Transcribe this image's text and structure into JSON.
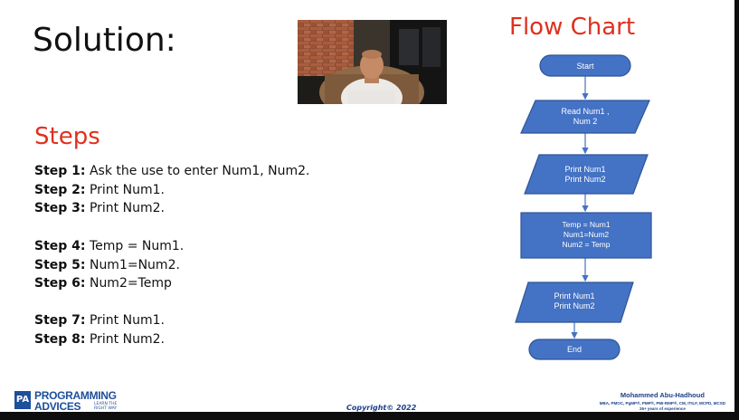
{
  "slide": {
    "title": "Solution:",
    "steps_heading": "Steps",
    "steps": [
      {
        "label": "Step 1:",
        "text": " Ask the use to enter Num1, Num2."
      },
      {
        "label": "Step 2:",
        "text": " Print Num1."
      },
      {
        "label": "Step 3:",
        "text": " Print Num2."
      },
      {
        "label": "Step 4:",
        "text": " Temp = Num1."
      },
      {
        "label": "Step 5:",
        "text": " Num1=Num2."
      },
      {
        "label": "Step 6:",
        "text": " Num2=Temp"
      },
      {
        "label": "Step 7:",
        "text": " Print Num1."
      },
      {
        "label": "Step 8:",
        "text": " Print Num2."
      }
    ],
    "flowchart": {
      "title": "Flow Chart",
      "start": "Start",
      "read": [
        "Read Num1 ,",
        "Num 2"
      ],
      "print1": [
        "Print Num1",
        "Print Num2"
      ],
      "process": [
        "Temp = Num1",
        "Num1=Num2",
        "Num2 = Temp"
      ],
      "print2": [
        "Print Num1",
        "Print Num2"
      ],
      "end": "End"
    },
    "copyright": "Copyright© 2022",
    "logo": {
      "line1": "PROGRAMMING",
      "line2": "ADVICES",
      "tagline": "LEARN THE RIGHT WAY",
      "mark": "PA"
    },
    "author": {
      "name": "Mohammed Abu-Hadhoud",
      "credentials": "MBA, PMOC, PgMP®, PMP®, PMI-RMP®, CM, ITILF, MCPD, MCSD",
      "experience": "26+ years of experience"
    }
  },
  "colors": {
    "accent_red": "#e0301e",
    "shape_fill": "#4472c4",
    "shape_stroke": "#2f5597",
    "brand_blue": "#1d4f9b"
  }
}
